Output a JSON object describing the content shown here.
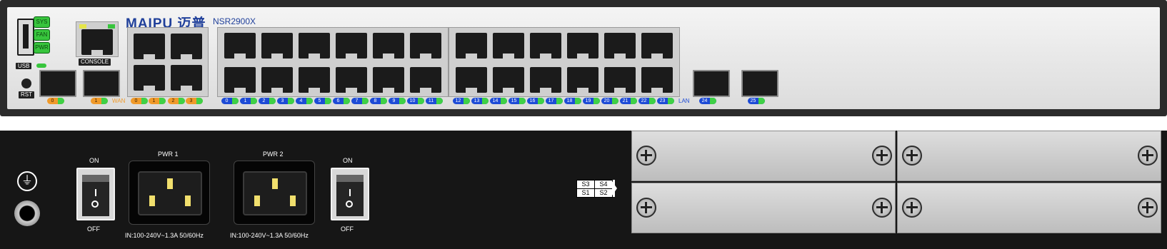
{
  "front": {
    "brand": "MAIPU 迈普",
    "model": "NSR2900X",
    "leds": [
      "SYS",
      "FAN",
      "PWR"
    ],
    "usb_label": "USB",
    "rst_label": "RST",
    "console_label": "CONSOLE",
    "wan_label": "WAN",
    "lan_label": "LAN",
    "sfp_port_labels": [
      "0",
      "1"
    ],
    "ge_wan_labels": [
      "0",
      "1",
      "2",
      "3"
    ],
    "lan_port_labels": [
      "0",
      "1",
      "2",
      "3",
      "4",
      "5",
      "6",
      "7",
      "8",
      "9",
      "10",
      "11",
      "12",
      "13",
      "14",
      "15",
      "16",
      "17",
      "18",
      "19",
      "20",
      "21",
      "22",
      "23"
    ],
    "sfp_lan_labels": [
      "24",
      "25"
    ]
  },
  "rear": {
    "ground_symbol": "⏚",
    "switch1": {
      "on": "ON",
      "off": "OFF"
    },
    "switch2": {
      "on": "ON",
      "off": "OFF"
    },
    "pwr1": {
      "label": "PWR 1",
      "spec": "IN:100-240V~1.3A 50/60Hz"
    },
    "pwr2": {
      "label": "PWR 2",
      "spec": "IN:100-240V~1.3A 50/60Hz"
    },
    "slot_map": {
      "s3": "S3",
      "s4": "S4",
      "s1": "S1",
      "s2": "S2"
    }
  },
  "colors": {
    "brand": "#1f3f9a",
    "lan_led": "#1d4bd6",
    "wan_led": "#f09a2a",
    "status_led": "#38c53d"
  }
}
